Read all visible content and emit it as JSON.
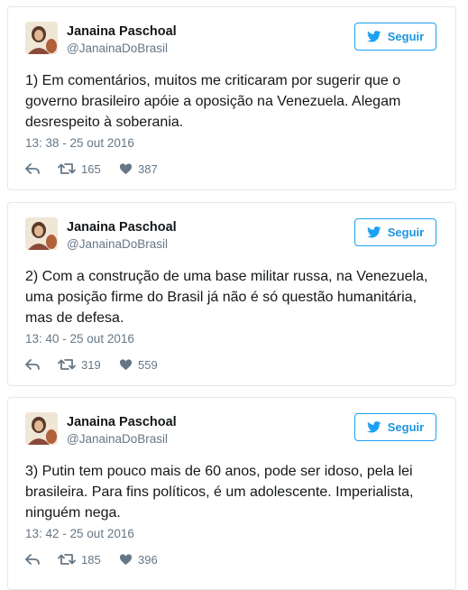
{
  "tweets": [
    {
      "name": "Janaina Paschoal",
      "handle": "@JanainaDoBrasil",
      "follow_label": "Seguir",
      "text": "1) Em comentários, muitos me criticaram por sugerir que o governo brasileiro apóie a oposição na Venezuela. Alegam desrespeito à soberania.",
      "time": "13: 38 - 25 out 2016",
      "retweets": "165",
      "likes": "387"
    },
    {
      "name": "Janaina Paschoal",
      "handle": "@JanainaDoBrasil",
      "follow_label": "Seguir",
      "text": "2) Com a construção de uma base militar russa, na Venezuela, uma posição firme do Brasil já não é só questão humanitária, mas de defesa.",
      "time": "13: 40 - 25 out 2016",
      "retweets": "319",
      "likes": "559"
    },
    {
      "name": "Janaina Paschoal",
      "handle": "@JanainaDoBrasil",
      "follow_label": "Seguir",
      "text": "3) Putin tem pouco mais de 60 anos, pode ser idoso, pela lei brasileira. Para fins políticos, é um adolescente. Imperialista, ninguém nega.",
      "time": "13: 42 - 25 out 2016",
      "retweets": "185",
      "likes": "396"
    }
  ],
  "colors": {
    "twitter_blue": "#1da1f2",
    "border": "#e1e8ed",
    "muted": "#657786",
    "text": "#14171a"
  },
  "icons": {
    "bird": "twitter-bird-icon",
    "reply": "reply-icon",
    "retweet": "retweet-icon",
    "like": "heart-icon"
  }
}
